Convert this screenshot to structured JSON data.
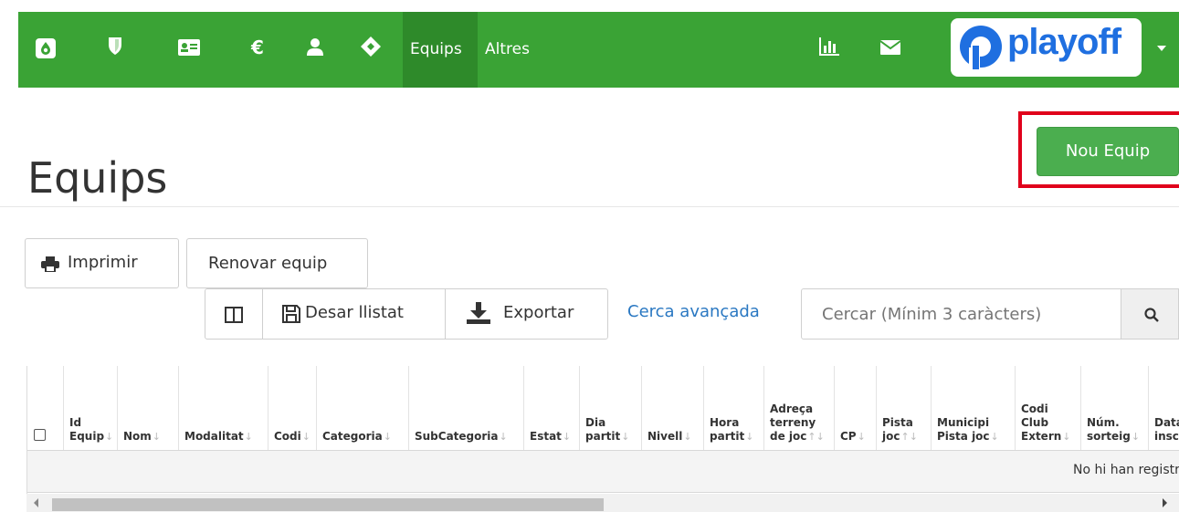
{
  "topbar": {
    "nav": [
      {
        "label": "Equips",
        "active": true
      },
      {
        "label": "Altres",
        "active": false
      }
    ],
    "icons": [
      "drop-icon",
      "shield-icon",
      "id-card-icon",
      "euro-icon",
      "user-icon",
      "ticket-icon",
      "bar-chart-icon",
      "envelope-icon"
    ],
    "brand": "playoff",
    "colors": {
      "bar": "#3aa335",
      "active": "#2e8a2a",
      "brand": "#1f6fe0"
    }
  },
  "page": {
    "title": "Equips",
    "new_button": "Nou Equip"
  },
  "toolbar": {
    "print": "Imprimir",
    "renew": "Renovar equip",
    "save_list": "Desar llistat",
    "export": "Exportar",
    "advanced_search": "Cerca avançada",
    "search_placeholder": "Cercar (Mínim 3 caràcters)"
  },
  "table": {
    "columns": [
      {
        "label": "Id Equip",
        "sort": "↓"
      },
      {
        "label": "Nom",
        "sort": "↓"
      },
      {
        "label": "Modalitat",
        "sort": "↓"
      },
      {
        "label": "Codi",
        "sort": "↓"
      },
      {
        "label": "Categoria",
        "sort": "↓"
      },
      {
        "label": "SubCategoria",
        "sort": "↓"
      },
      {
        "label": "Estat",
        "sort": "↓"
      },
      {
        "label": "Dia partit",
        "sort": "↓"
      },
      {
        "label": "Nivell",
        "sort": "↓"
      },
      {
        "label": "Hora partit",
        "sort": "↓"
      },
      {
        "label": "Adreça terreny de joc",
        "sort": "↑↓"
      },
      {
        "label": "CP",
        "sort": "↓"
      },
      {
        "label": "Pista joc",
        "sort": "↑↓"
      },
      {
        "label": "Municipi Pista joc",
        "sort": "↓"
      },
      {
        "label": "Codi Club Extern",
        "sort": "↓"
      },
      {
        "label": "Núm. sorteig",
        "sort": "↓"
      },
      {
        "label": "Data inscripció",
        "sort": ""
      }
    ],
    "empty_message": "No hi han registres"
  }
}
